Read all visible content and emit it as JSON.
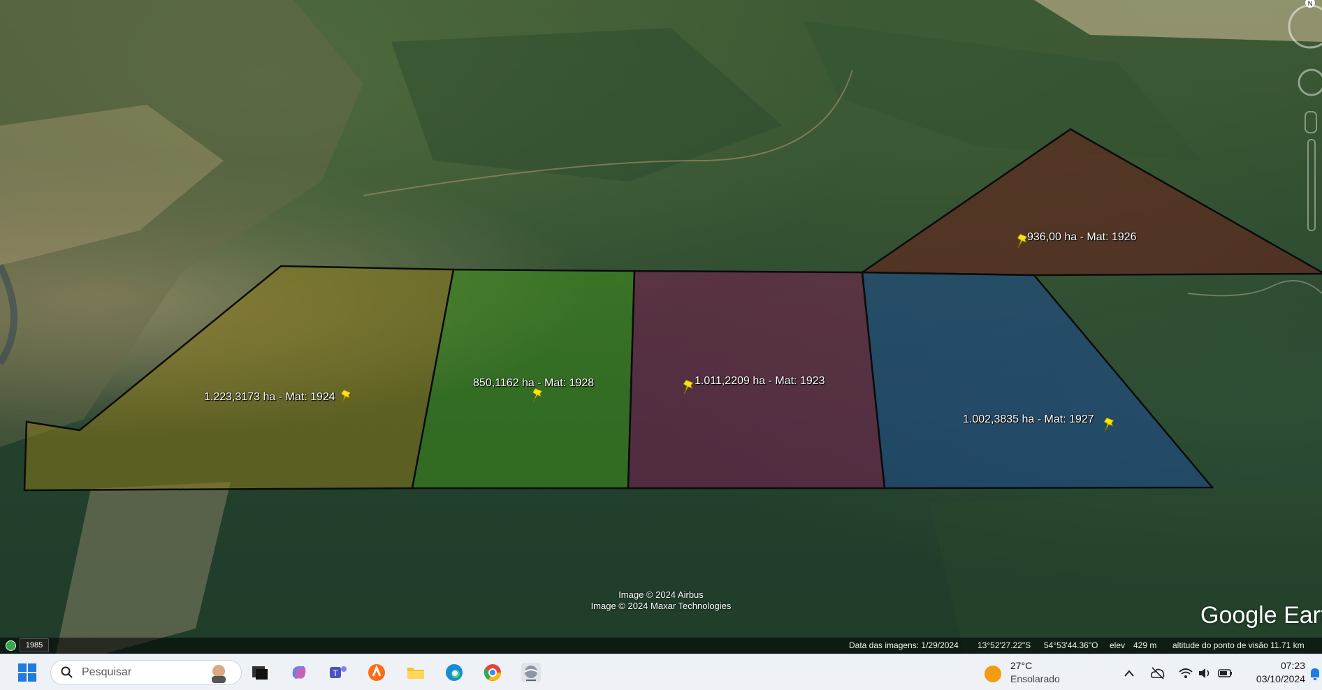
{
  "parcels": [
    {
      "label": "1.223,3173 ha - Mat: 1924",
      "fill": "#8a7a1c"
    },
    {
      "label": "850,1162 ha - Mat: 1928",
      "fill": "#3f8f1e"
    },
    {
      "label": "1.011,2209 ha - Mat: 1923",
      "fill": "#7a1d52"
    },
    {
      "label": "1.002,3835 ha - Mat: 1927",
      "fill": "#1e4a92"
    },
    {
      "label": "936,00 ha - Mat: 1926",
      "fill": "#6a1e1a"
    }
  ],
  "credits": {
    "line1": "Image © 2024 Airbus",
    "line2": "Image © 2024 Maxar Technologies"
  },
  "brand": "Google Eart",
  "historical_year": "1985",
  "status": {
    "imagery_date": "Data das imagens: 1/29/2024",
    "lat": "13°52'27.22\"S",
    "lon": "54°53'44.36\"O",
    "elev_label": "elev",
    "elev_value": "429 m",
    "eye_alt": "altitude do ponto de visão  11.71 km"
  },
  "compass_letter": "N",
  "taskbar": {
    "search_placeholder": "Pesquisar",
    "weather_temp": "27°C",
    "weather_condition": "Ensolarado",
    "time": "07:23",
    "date": "03/10/2024",
    "apps": [
      "task-view",
      "copilot",
      "teams",
      "avast",
      "file-explorer",
      "edge",
      "chrome",
      "google-earth"
    ]
  }
}
